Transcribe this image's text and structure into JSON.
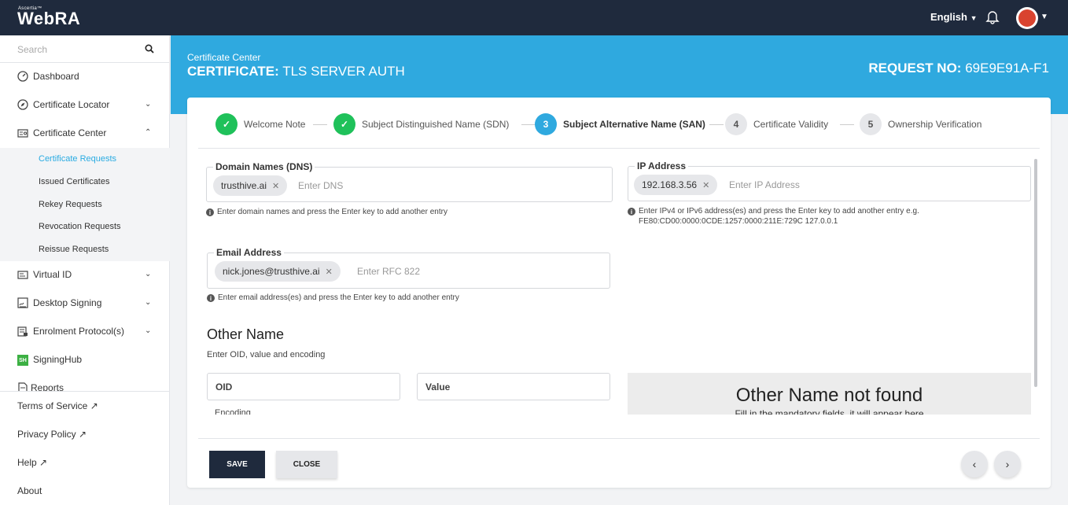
{
  "app": {
    "brand_small": "Ascertia™",
    "brand": "WebRA",
    "language": "English"
  },
  "sidebar": {
    "search_placeholder": "Search",
    "items": [
      {
        "label": "Dashboard",
        "icon": "dashboard-icon"
      },
      {
        "label": "Certificate Locator",
        "icon": "compass-icon"
      },
      {
        "label": "Certificate Center",
        "icon": "certificate-icon"
      },
      {
        "label": "Virtual ID",
        "icon": "id-card-icon"
      },
      {
        "label": "Desktop Signing",
        "icon": "signing-icon"
      },
      {
        "label": "Enrolment Protocol(s)",
        "icon": "protocol-icon"
      },
      {
        "label": "SigningHub",
        "icon": "signinghub-icon"
      },
      {
        "label": "Reports",
        "icon": "report-icon"
      }
    ],
    "submenu": [
      {
        "label": "Certificate Requests",
        "active": true
      },
      {
        "label": "Issued Certificates"
      },
      {
        "label": "Rekey Requests"
      },
      {
        "label": "Revocation Requests"
      },
      {
        "label": "Reissue Requests"
      }
    ],
    "footer": [
      "Terms of Service",
      "Privacy Policy",
      "Help",
      "About"
    ],
    "signinghub_badge": "SH"
  },
  "header": {
    "section": "Certificate Center",
    "title_bold": "CERTIFICATE:",
    "title_rest": "TLS SERVER AUTH",
    "request_label": "REQUEST NO:",
    "request_value": "69E9E91A-F1"
  },
  "steps": [
    {
      "label": "Welcome Note",
      "state": "done"
    },
    {
      "label": "Subject Distinguished Name (SDN)",
      "state": "done"
    },
    {
      "num": "3",
      "label": "Subject Alternative Name (SAN)",
      "state": "current"
    },
    {
      "num": "4",
      "label": "Certificate Validity",
      "state": "todo"
    },
    {
      "num": "5",
      "label": "Ownership Verification",
      "state": "todo"
    }
  ],
  "fields": {
    "dns": {
      "label": "Domain Names (DNS)",
      "chip": "trusthive.ai",
      "placeholder": "Enter DNS",
      "hint": "Enter domain names and press the Enter key to add another entry"
    },
    "ip": {
      "label": "IP Address",
      "chip": "192.168.3.56",
      "placeholder": "Enter IP Address",
      "hint_line1": "Enter IPv4 or IPv6 address(es) and press the Enter key to add another entry e.g.",
      "hint_line2": "FE80:CD00:0000:0CDE:1257:0000:211E:729C 127.0.0.1"
    },
    "email": {
      "label": "Email Address",
      "chip": "nick.jones@trusthive.ai",
      "placeholder": "Enter RFC 822",
      "hint": "Enter email address(es) and press the Enter key to add another entry"
    }
  },
  "other_name": {
    "title": "Other Name",
    "subtitle": "Enter OID, value and encoding",
    "oid_placeholder": "OID",
    "value_placeholder": "Value",
    "encoding_label": "Encoding",
    "empty_title": "Other Name not found",
    "empty_sub": "Fill in the mandatory fields, it will appear here"
  },
  "actions": {
    "save": "SAVE",
    "close": "CLOSE",
    "prev": "‹",
    "next": "›"
  },
  "colors": {
    "topbar": "#1f2a3d",
    "banner": "#2fa9df",
    "done": "#1fc15a",
    "active": "#29abe2"
  }
}
